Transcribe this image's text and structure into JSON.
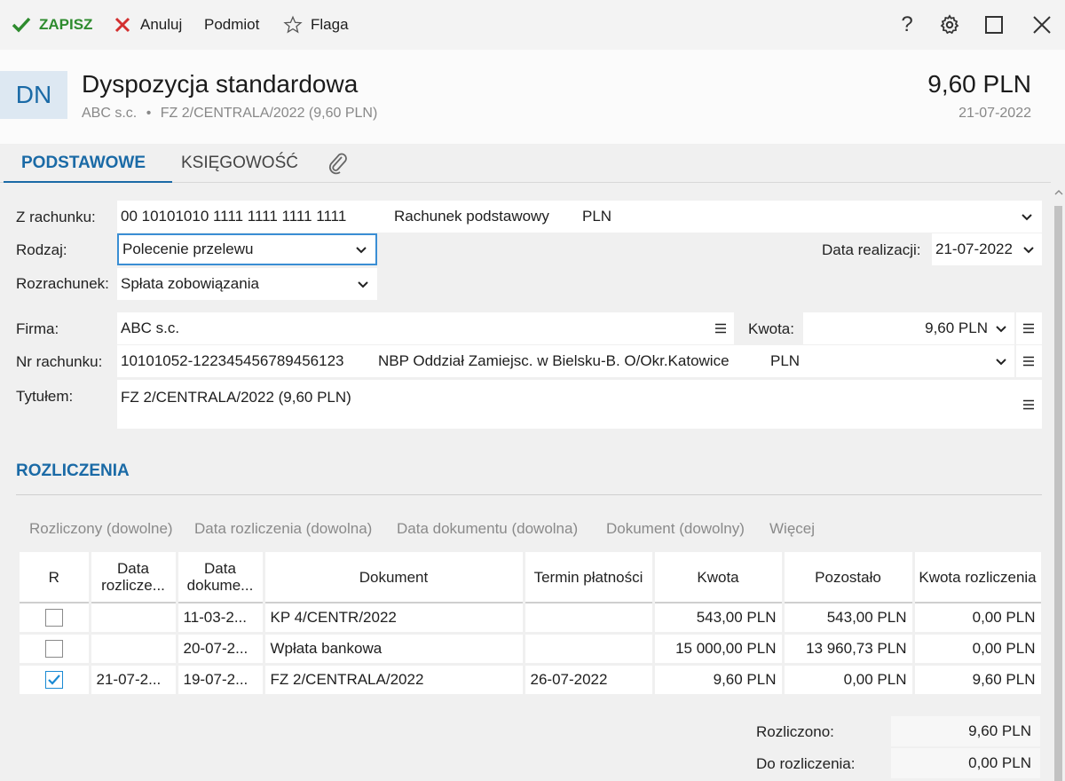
{
  "toolbar": {
    "save_label": "ZAPISZ",
    "cancel_label": "Anuluj",
    "subject_label": "Podmiot",
    "flag_label": "Flaga",
    "help_label": "?"
  },
  "header": {
    "badge": "DN",
    "title": "Dyspozycja standardowa",
    "company": "ABC s.c.",
    "separator": "•",
    "reference": "FZ 2/CENTRALA/2022 (9,60 PLN)",
    "amount": "9,60 PLN",
    "date": "21-07-2022"
  },
  "tabs": [
    {
      "label": "PODSTAWOWE",
      "active": true
    },
    {
      "label": "KSIĘGOWOŚĆ",
      "active": false
    }
  ],
  "form": {
    "from_account_label": "Z rachunku:",
    "from_account_number": "00 10101010 1111 1111 1111 1111",
    "from_account_name": "Rachunek podstawowy",
    "from_account_currency": "PLN",
    "type_label": "Rodzaj:",
    "type_value": "Polecenie przelewu",
    "settlement_label": "Rozrachunek:",
    "settlement_value": "Spłata zobowiązania",
    "exec_date_label": "Data realizacji:",
    "exec_date_value": "21-07-2022",
    "company_label": "Firma:",
    "company_value": "ABC s.c.",
    "amount_label": "Kwota:",
    "amount_value": "9,60 PLN",
    "account_no_label": "Nr rachunku:",
    "account_no_value": "10101052-122345456789456123",
    "bank_name": "NBP Oddział Zamiejsc. w Bielsku-B.  O/Okr.Katowice",
    "account_currency": "PLN",
    "title_label": "Tytułem:",
    "title_value": "FZ 2/CENTRALA/2022 (9,60 PLN)"
  },
  "settlements": {
    "section_title": "ROZLICZENIA",
    "filters": [
      "Rozliczony (dowolne)",
      "Data rozliczenia (dowolna)",
      "Data dokumentu (dowolna)",
      "Dokument (dowolny)",
      "Więcej"
    ],
    "columns": [
      "R",
      "Data rozlicze...",
      "Data dokume...",
      "Dokument",
      "Termin płatności",
      "Kwota",
      "Pozostało",
      "Kwota rozliczenia"
    ],
    "rows": [
      {
        "checked": false,
        "settle_date": "",
        "doc_date": "11-03-2...",
        "document": "KP 4/CENTR/2022",
        "due_date": "",
        "amount": "543,00 PLN",
        "remaining": "543,00 PLN",
        "settle_amount": "0,00 PLN"
      },
      {
        "checked": false,
        "settle_date": "",
        "doc_date": "20-07-2...",
        "document": "Wpłata bankowa",
        "due_date": "",
        "amount": "15 000,00 PLN",
        "remaining": "13 960,73 PLN",
        "settle_amount": "0,00 PLN"
      },
      {
        "checked": true,
        "settle_date": "21-07-2...",
        "doc_date": "19-07-2...",
        "document": "FZ 2/CENTRALA/2022",
        "due_date": "26-07-2022",
        "amount": "9,60 PLN",
        "remaining": "0,00 PLN",
        "settle_amount": "9,60 PLN"
      }
    ],
    "settled_label": "Rozliczono:",
    "settled_value": "9,60 PLN",
    "to_settle_label": "Do rozliczenia:",
    "to_settle_value": "0,00 PLN"
  },
  "colors": {
    "accent": "#1a6aa6",
    "save_green": "#2e8b2e",
    "cancel_red": "#d32f2f"
  }
}
